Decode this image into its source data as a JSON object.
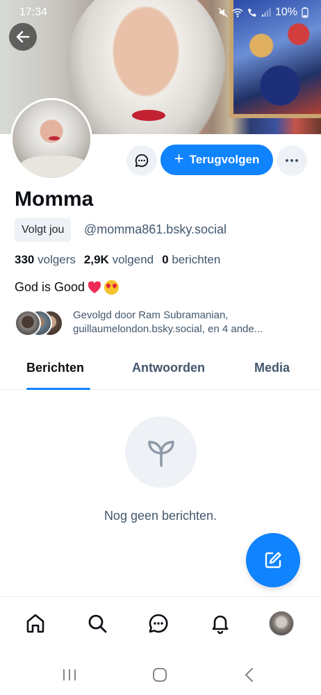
{
  "status_bar": {
    "time": "17:34",
    "battery": "10%",
    "icons": [
      "mute-icon",
      "wifi-icon",
      "call-icon",
      "signal-icon",
      "battery-icon"
    ]
  },
  "profile": {
    "display_name": "Momma",
    "follows_you_badge": "Volgt jou",
    "handle": "@momma861.bsky.social",
    "bio_text": "God is Good",
    "bio_emojis": [
      "heart-emoji",
      "heart-eyes-emoji"
    ],
    "stats": {
      "followers_count": "330",
      "followers_label": "volgers",
      "following_count": "2,9K",
      "following_label": "volgend",
      "posts_count": "0",
      "posts_label": "berichten"
    },
    "followed_by": {
      "line1": "Gevolgd door Ram Subramanian,",
      "line2": "guillaumelondon.bsky.social, en 4 ande..."
    }
  },
  "actions": {
    "follow_back_label": "Terugvolgen"
  },
  "tabs": [
    {
      "label": "Berichten",
      "active": true
    },
    {
      "label": "Antwoorden",
      "active": false
    },
    {
      "label": "Media",
      "active": false
    }
  ],
  "empty_state": {
    "text": "Nog geen berichten."
  },
  "bottom_nav": [
    "home-icon",
    "search-icon",
    "chat-icon",
    "bell-icon",
    "profile-avatar"
  ],
  "colors": {
    "accent": "#1083fe",
    "secondary_text": "#42576c",
    "chip_bg": "#eef2f6"
  }
}
